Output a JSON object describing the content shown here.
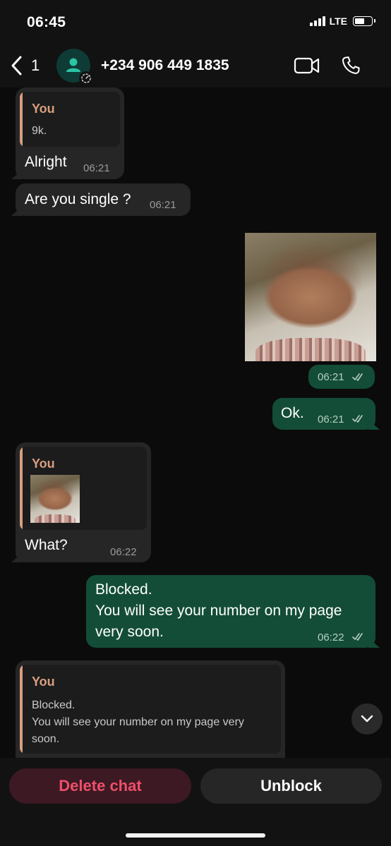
{
  "status": {
    "time": "06:45",
    "network": "LTE",
    "signal_bars": 4,
    "battery_level": 0.6,
    "battery_icon": "battery-icon"
  },
  "header": {
    "back_count": "1",
    "contact_name": "+234 906 449 1835",
    "icons": [
      "back-chevron-icon",
      "contact-avatar-icon",
      "disappearing-timer-icon",
      "video-call-icon",
      "phone-icon"
    ]
  },
  "messages": [
    {
      "direction": "incoming",
      "quote_author": "You",
      "quote_text": "9k.",
      "text": "Alright",
      "time": "06:21"
    },
    {
      "direction": "incoming",
      "text": "Are you single ?",
      "time": "06:21"
    },
    {
      "direction": "outgoing",
      "type": "image",
      "time": "06:21",
      "status": "read"
    },
    {
      "direction": "outgoing",
      "text": "Ok.",
      "time": "06:21",
      "status": "read"
    },
    {
      "direction": "incoming",
      "quote_author": "You",
      "quote_type": "image",
      "text": "What?",
      "time": "06:22"
    },
    {
      "direction": "outgoing",
      "lines": [
        "Blocked.",
        "You will see your number on my page",
        "very soon."
      ],
      "time": "06:22",
      "status": "read"
    },
    {
      "direction": "incoming",
      "quote_author": "You",
      "quote_lines": [
        "Blocked.",
        "You will see your number on my page very",
        "soon."
      ]
    }
  ],
  "actions": {
    "delete_label": "Delete chat",
    "unblock_label": "Unblock"
  },
  "colors": {
    "background": "#0b0b0b",
    "incoming_bubble": "#262626",
    "outgoing_bubble": "#134d37",
    "quote_accent": "#d89e7e",
    "delete_text": "#ee4f6b"
  }
}
